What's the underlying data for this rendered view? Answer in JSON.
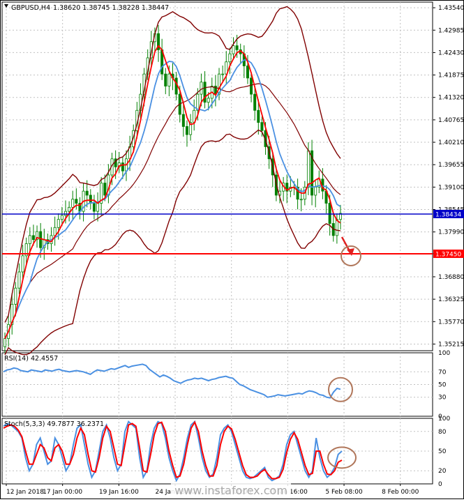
{
  "header": {
    "symbol": "GBPUSD,H4",
    "ohlc": "1.38620 1.38745 1.38228 1.38447"
  },
  "colors": {
    "background": "#ffffff",
    "grid": "#c0c0c0",
    "candle": "#008000",
    "bollinger": "#800000",
    "ma_fast": "#ff0000",
    "ma_slow": "#4a90e2",
    "current_price_line": "#0000c8",
    "target_line": "#ff0000",
    "annotation_circle": "#b0765a",
    "arrow": "#e02020"
  },
  "chart_data": [
    {
      "type": "candlestick",
      "title": "GBPUSD,H4",
      "y_ticks": [
        "1.43540",
        "1.42985",
        "1.42430",
        "1.41875",
        "1.41320",
        "1.40765",
        "1.40210",
        "1.39655",
        "1.39100",
        "1.38545",
        "1.37990",
        "1.37450",
        "1.36880",
        "1.36325",
        "1.35770",
        "1.35215"
      ],
      "ylim": [
        1.3505,
        1.4368
      ],
      "x_ticks": [
        "12 Jan 2018",
        "17 Jan 00:00",
        "19 Jan 16:00",
        "24 Jan 08:00",
        "29 Jan 00:00",
        "31 Jan 16:00",
        "5 Feb 08:00",
        "8 Feb 00:00"
      ],
      "price_labels": [
        {
          "name": "current",
          "value": "1.38434"
        },
        {
          "name": "target",
          "value": "1.37450"
        }
      ],
      "closes": [
        1.3535,
        1.357,
        1.362,
        1.366,
        1.37,
        1.374,
        1.377,
        1.379,
        1.378,
        1.38,
        1.376,
        1.378,
        1.377,
        1.379,
        1.381,
        1.383,
        1.384,
        1.385,
        1.386,
        1.388,
        1.387,
        1.385,
        1.39,
        1.389,
        1.387,
        1.385,
        1.387,
        1.392,
        1.389,
        1.394,
        1.398,
        1.396,
        1.397,
        1.395,
        1.398,
        1.401,
        1.405,
        1.41,
        1.414,
        1.419,
        1.423,
        1.427,
        1.429,
        1.425,
        1.419,
        1.416,
        1.419,
        1.418,
        1.414,
        1.409,
        1.406,
        1.404,
        1.407,
        1.41,
        1.414,
        1.417,
        1.412,
        1.413,
        1.416,
        1.414,
        1.419,
        1.419,
        1.422,
        1.424,
        1.426,
        1.425,
        1.424,
        1.421,
        1.418,
        1.414,
        1.41,
        1.407,
        1.405,
        1.401,
        1.398,
        1.394,
        1.389,
        1.39,
        1.392,
        1.39,
        1.391,
        1.391,
        1.388,
        1.388,
        1.391,
        1.4,
        1.389,
        1.391,
        1.393,
        1.39,
        1.387,
        1.382,
        1.379,
        1.383,
        1.3845
      ]
    },
    {
      "type": "line",
      "title": "RSI(14) 42.4557",
      "y_ticks": [
        "100",
        "70",
        "50",
        "30",
        "0"
      ],
      "ylim": [
        0,
        100
      ],
      "values": [
        70,
        73,
        74,
        76,
        75,
        72,
        71,
        70,
        73,
        72,
        71,
        70,
        73,
        72,
        71,
        73,
        74,
        72,
        71,
        70,
        71,
        72,
        71,
        70,
        68,
        66,
        70,
        73,
        72,
        71,
        73,
        75,
        74,
        76,
        78,
        80,
        77,
        79,
        80,
        81,
        82,
        80,
        74,
        70,
        66,
        62,
        65,
        63,
        60,
        56,
        54,
        52,
        55,
        57,
        58,
        60,
        59,
        60,
        58,
        56,
        58,
        59,
        61,
        62,
        63,
        61,
        60,
        55,
        50,
        48,
        45,
        42,
        40,
        38,
        36,
        34,
        30,
        31,
        32,
        34,
        33,
        32,
        33,
        34,
        35,
        36,
        35,
        38,
        40,
        39,
        37,
        34,
        33,
        30,
        29,
        38,
        44,
        42.5
      ]
    },
    {
      "type": "line",
      "title": "Stoch(5,3,3) 49.7877 36.2371",
      "y_ticks": [
        "100",
        "80",
        "50",
        "20",
        "0"
      ],
      "ylim": [
        0,
        100
      ],
      "series": [
        {
          "name": "main",
          "color": "#4a90e2",
          "values": [
            88,
            92,
            90,
            85,
            80,
            70,
            40,
            20,
            30,
            60,
            70,
            50,
            30,
            35,
            70,
            60,
            40,
            20,
            30,
            60,
            85,
            90,
            60,
            30,
            10,
            20,
            50,
            80,
            90,
            70,
            40,
            20,
            30,
            80,
            95,
            90,
            85,
            40,
            10,
            20,
            60,
            85,
            95,
            92,
            70,
            40,
            20,
            5,
            15,
            40,
            70,
            90,
            95,
            70,
            40,
            20,
            10,
            15,
            40,
            75,
            85,
            90,
            80,
            60,
            40,
            20,
            10,
            8,
            10,
            15,
            20,
            25,
            10,
            5,
            8,
            12,
            30,
            60,
            75,
            80,
            60,
            40,
            20,
            10,
            20,
            70,
            40,
            20,
            10,
            15,
            25,
            45,
            50
          ]
        },
        {
          "name": "signal",
          "color": "#ff0000",
          "values": [
            85,
            88,
            90,
            88,
            82,
            72,
            50,
            30,
            30,
            45,
            60,
            55,
            40,
            35,
            55,
            60,
            50,
            30,
            30,
            45,
            70,
            85,
            75,
            45,
            20,
            18,
            40,
            70,
            88,
            80,
            55,
            30,
            28,
            60,
            90,
            92,
            88,
            55,
            20,
            18,
            45,
            75,
            92,
            94,
            80,
            50,
            28,
            10,
            12,
            30,
            60,
            85,
            94,
            80,
            50,
            28,
            12,
            12,
            28,
            60,
            80,
            88,
            84,
            68,
            48,
            28,
            14,
            10,
            10,
            12,
            18,
            22,
            14,
            8,
            8,
            10,
            22,
            48,
            68,
            78,
            68,
            48,
            28,
            14,
            16,
            50,
            50,
            30,
            15,
            14,
            20,
            33,
            36.2
          ]
        }
      ]
    }
  ],
  "watermark": {
    "text": "www.instaforex.com"
  }
}
